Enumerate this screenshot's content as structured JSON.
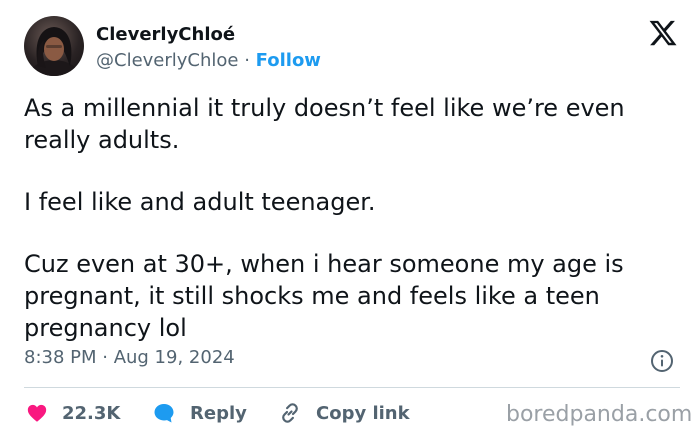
{
  "author": {
    "name": "CleverlyChloé",
    "handle": "@CleverlyChloe",
    "separator": " · ",
    "follow_label": "Follow"
  },
  "tweet": {
    "paragraphs": [
      "As a millennial it truly doesn’t feel like we’re even really adults.",
      "I feel like and adult teenager.",
      "Cuz even at 30+, when i hear someone my age is pregnant, it still shocks me and feels like a teen pregnancy lol"
    ],
    "timestamp": "8:38 PM · Aug 19, 2024"
  },
  "actions": {
    "likes": "22.3K",
    "reply_label": "Reply",
    "copy_link_label": "Copy link"
  },
  "watermark": "boredpanda.com",
  "icons": {
    "platform": "x-logo-icon",
    "info": "info-icon",
    "like": "heart-icon",
    "reply": "speech-bubble-icon",
    "copy_link": "link-icon"
  },
  "colors": {
    "text": "#0f1419",
    "secondary": "#536471",
    "follow": "#1d9bf0",
    "like": "#f91880",
    "reply": "#1d9bf0",
    "divider": "#cfd9de"
  }
}
